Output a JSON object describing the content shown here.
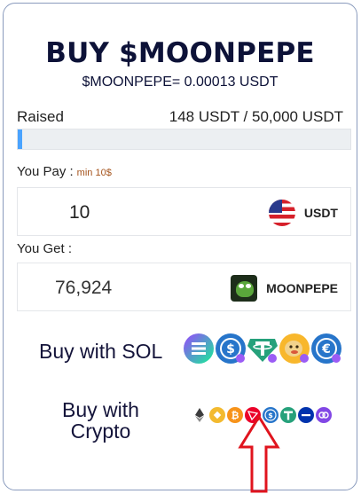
{
  "header": {
    "title": "BUY $MOONPEPE",
    "price": "$MOONPEPE= 0.00013 USDT"
  },
  "raised": {
    "label": "Raised",
    "amount": "148 USDT / 50,000 USDT",
    "progress_fraction": 0.003,
    "bar_color": "#4aa3ff"
  },
  "pay": {
    "label": "You Pay :",
    "min_note": "min 10$",
    "value": "10",
    "token": "USDT",
    "token_icon": "us-flag-icon"
  },
  "get": {
    "label": "You Get :",
    "value": "76,924",
    "token": "MOONPEPE",
    "token_icon": "pepe-icon"
  },
  "buy_sol": {
    "label": "Buy with SOL",
    "icons": [
      "solana-icon",
      "usdc-sol-icon",
      "tether-sol-icon",
      "bonk-sol-icon",
      "euro-coin-sol-icon"
    ]
  },
  "buy_crypto": {
    "label": "Buy with Crypto",
    "line1": "Buy with",
    "line2": "Crypto",
    "icons": [
      "ethereum-icon",
      "bnb-icon",
      "bitcoin-icon",
      "tron-icon",
      "usdc-icon",
      "tether-icon",
      "cardano-icon",
      "polygon-icon"
    ]
  },
  "colors": {
    "title": "#0d1238",
    "accent_arrow": "#e0141e",
    "card_border": "#8a9bbd"
  }
}
